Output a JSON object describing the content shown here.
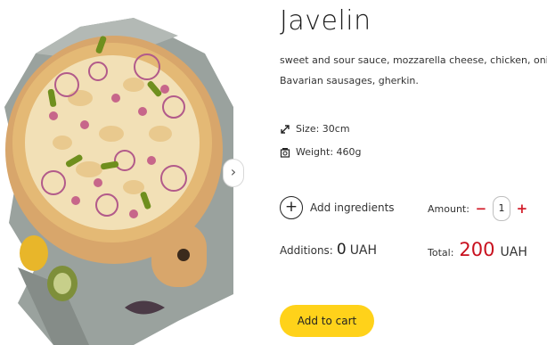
{
  "product": {
    "title": "Javelin",
    "description_line1": "sweet and sour sauce, mozzarella cheese, chicken, onions,",
    "description_line2": "Bavarian sausages, gherkin."
  },
  "specs": {
    "size_label": "Size: 30cm",
    "size_icon": "resize-arrows-icon",
    "weight_label": "Weight: 460g",
    "weight_icon": "scale-icon"
  },
  "gallery": {
    "image": "pizza-photo",
    "next_icon": "chevron-right-icon",
    "next_glyph": "›"
  },
  "ingredients": {
    "add_symbol": "+",
    "add_label": "Add ingredients"
  },
  "amount": {
    "label": "Amount:",
    "minus": "−",
    "value": "1",
    "plus": "+"
  },
  "additions": {
    "label": "Additions:",
    "value": "0",
    "currency": "UAH"
  },
  "total": {
    "label": "Total:",
    "value": "200",
    "currency": "UAH"
  },
  "cart": {
    "button_label": "Add to cart"
  },
  "colors": {
    "accent_yellow": "#ffd21a",
    "price_red": "#c8101e"
  }
}
